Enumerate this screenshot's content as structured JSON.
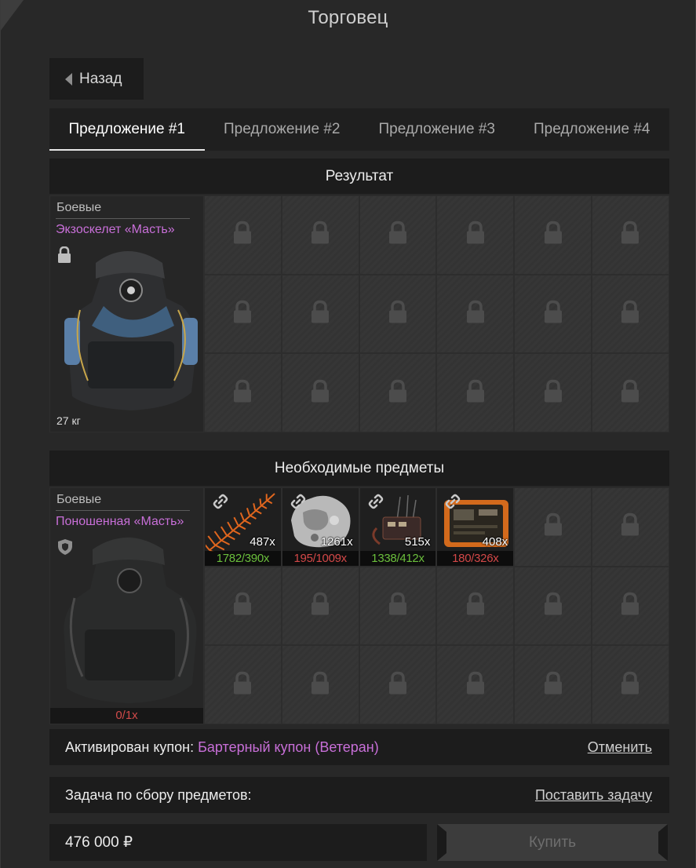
{
  "window": {
    "title": "Торговец"
  },
  "nav": {
    "back_label": "Назад"
  },
  "tabs": [
    {
      "label": "Предложение #1",
      "active": true
    },
    {
      "label": "Предложение #2",
      "active": false
    },
    {
      "label": "Предложение #3",
      "active": false
    },
    {
      "label": "Предложение #4",
      "active": false
    }
  ],
  "result": {
    "header": "Результат",
    "item": {
      "category": "Боевые",
      "name": "Экзоскелет «Масть»",
      "weight": "27 кг",
      "icon": "lock-icon"
    }
  },
  "required": {
    "header": "Необходимые предметы",
    "item": {
      "category": "Боевые",
      "name": "Поношенная «Масть»",
      "count": "0/1x",
      "icon": "shield-icon"
    },
    "materials": [
      {
        "name": "fern",
        "count": "487x",
        "have": "1782/390x",
        "status": "ok"
      },
      {
        "name": "rock",
        "count": "1261x",
        "have": "195/1009x",
        "status": "bad"
      },
      {
        "name": "device",
        "count": "515x",
        "have": "1338/412x",
        "status": "ok"
      },
      {
        "name": "tablet",
        "count": "408x",
        "have": "180/326x",
        "status": "bad"
      }
    ]
  },
  "coupon": {
    "label": "Активирован купон:",
    "name": "Бартерный купон (Ветеран)",
    "cancel_label": "Отменить"
  },
  "task": {
    "label": "Задача по сбору предметов:",
    "action_label": "Поставить задачу"
  },
  "price": {
    "value": "476 000 ₽"
  },
  "buy": {
    "label": "Купить"
  },
  "colors": {
    "rare_name": "#c86fd8",
    "ok": "#6bbf3c",
    "bad": "#d34848"
  }
}
